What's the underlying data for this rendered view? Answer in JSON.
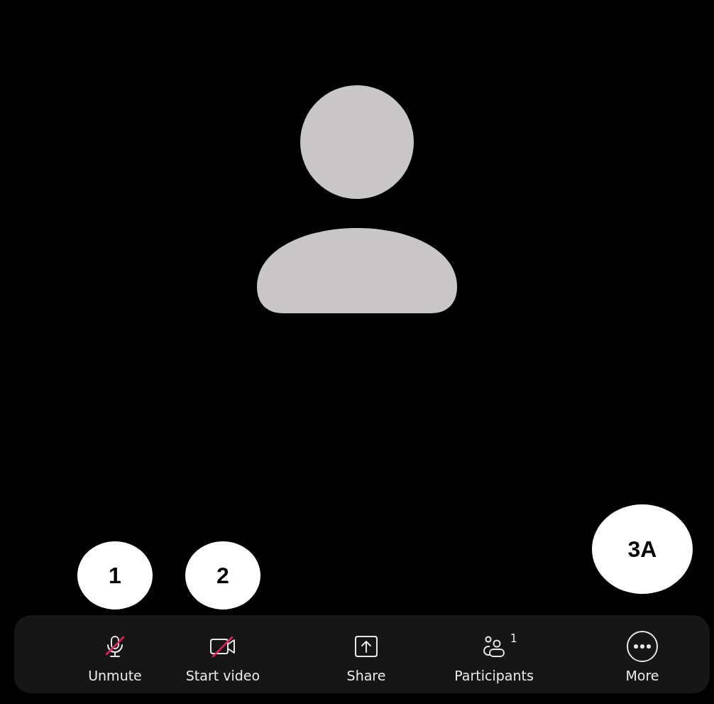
{
  "controls": [
    {
      "kind": "mic",
      "label": "Unmute",
      "off": true,
      "callout": "1"
    },
    {
      "kind": "video",
      "label": "Start video",
      "off": true,
      "callout": "2"
    },
    {
      "kind": "share",
      "label": "Share"
    },
    {
      "kind": "participants",
      "label": "Participants",
      "count": "1"
    },
    {
      "kind": "more",
      "label": "More",
      "callout": "3A"
    }
  ]
}
